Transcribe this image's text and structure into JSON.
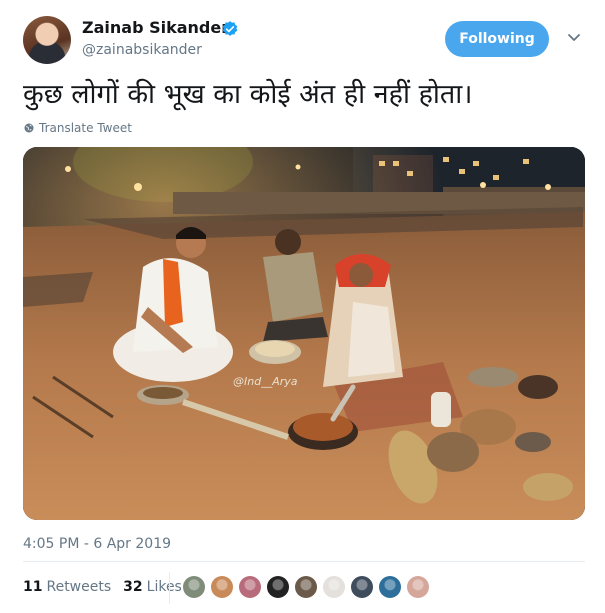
{
  "user": {
    "display_name": "Zainab Sikander",
    "handle": "@zainabsikander",
    "verified": true
  },
  "follow_button": {
    "label": "Following",
    "color": "#4aa7ee"
  },
  "menu": {
    "icon": "chevron-down-icon"
  },
  "tweet": {
    "text": "कुछ लोगों की भूख का कोई अंत ही नहीं होता।",
    "translate_label": "Translate Tweet",
    "media_watermark": "@Ind__Arya"
  },
  "meta": {
    "timestamp": "4:05 PM - 6 Apr 2019"
  },
  "stats": {
    "retweets_count": "11",
    "retweets_label": "Retweets",
    "likes_count": "32",
    "likes_label": "Likes"
  },
  "likers": [
    {
      "icon": "avatar-1",
      "color": "#7f8c7a"
    },
    {
      "icon": "avatar-2",
      "color": "#c98a5a"
    },
    {
      "icon": "avatar-3",
      "color": "#b86b7a"
    },
    {
      "icon": "avatar-4",
      "color": "#222222"
    },
    {
      "icon": "avatar-5",
      "color": "#6b5a4a"
    },
    {
      "icon": "avatar-6",
      "color": "#e4e0dc"
    },
    {
      "icon": "avatar-7",
      "color": "#3e4c5c"
    },
    {
      "icon": "avatar-8",
      "color": "#2d6f9a"
    },
    {
      "icon": "avatar-9",
      "color": "#d4a79a"
    }
  ]
}
